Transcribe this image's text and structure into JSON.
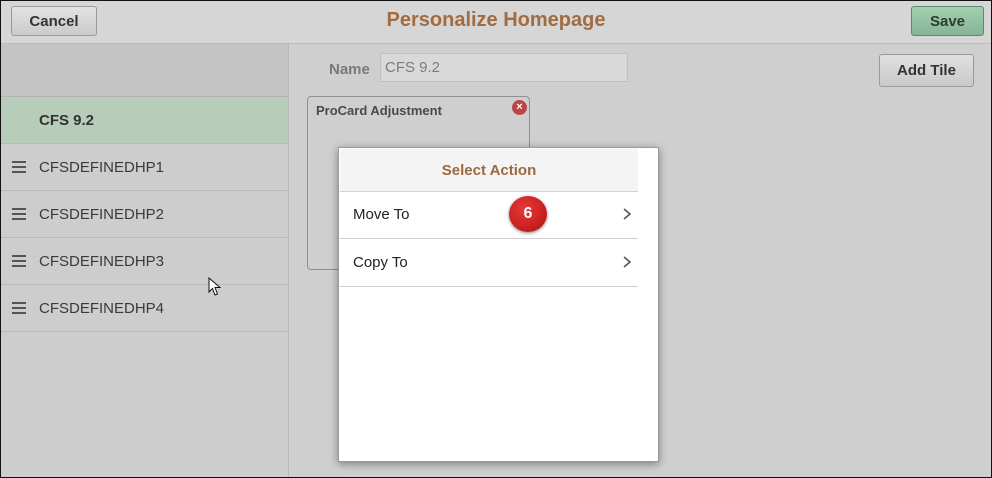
{
  "header": {
    "cancel_label": "Cancel",
    "title": "Personalize Homepage",
    "save_label": "Save"
  },
  "sidebar": {
    "items": [
      {
        "label": "CFS 9.2",
        "active": true
      },
      {
        "label": "CFSDEFINEDHP1"
      },
      {
        "label": "CFSDEFINEDHP2"
      },
      {
        "label": "CFSDEFINEDHP3"
      },
      {
        "label": "CFSDEFINEDHP4"
      }
    ]
  },
  "main": {
    "name_label": "Name",
    "name_value": "CFS 9.2",
    "add_tile_label": "Add Tile",
    "tile": {
      "title": "ProCard Adjustment"
    }
  },
  "modal": {
    "title": "Select Action",
    "items": [
      {
        "label": "Move To"
      },
      {
        "label": "Copy To"
      }
    ],
    "step_badge": "6"
  },
  "colors": {
    "title": "#a06c42",
    "save": "#94c3a2",
    "active_item": "#b7cdba",
    "badge": "#cc1e1e",
    "modal_title": "#9b6a3d"
  },
  "icons": [
    "drag-handle-icon",
    "close-icon",
    "chevron-right-icon",
    "mouse-cursor-icon"
  ]
}
